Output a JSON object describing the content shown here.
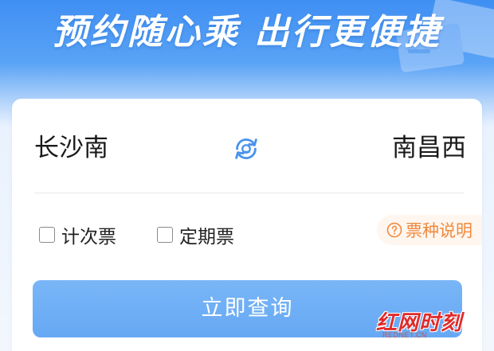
{
  "banner": {
    "title": "预约随心乘 出行更便捷"
  },
  "route": {
    "from_station": "长沙南",
    "to_station": "南昌西",
    "swap_icon": "swap-stations-icon"
  },
  "ticket_types": {
    "options": [
      {
        "label": "计次票",
        "checked": false
      },
      {
        "label": "定期票",
        "checked": false
      }
    ],
    "help_label": "票种说明",
    "help_icon": "question-circle-icon"
  },
  "query_button": {
    "label": "立即查询"
  },
  "watermark": {
    "logo_text": "红网时刻",
    "url": "REDNET.CN"
  },
  "colors": {
    "primary_blue": "#3f8ff3",
    "button_blue": "#6aaaf5",
    "accent_orange": "#f08a3e",
    "brand_red": "#e02a2a"
  }
}
